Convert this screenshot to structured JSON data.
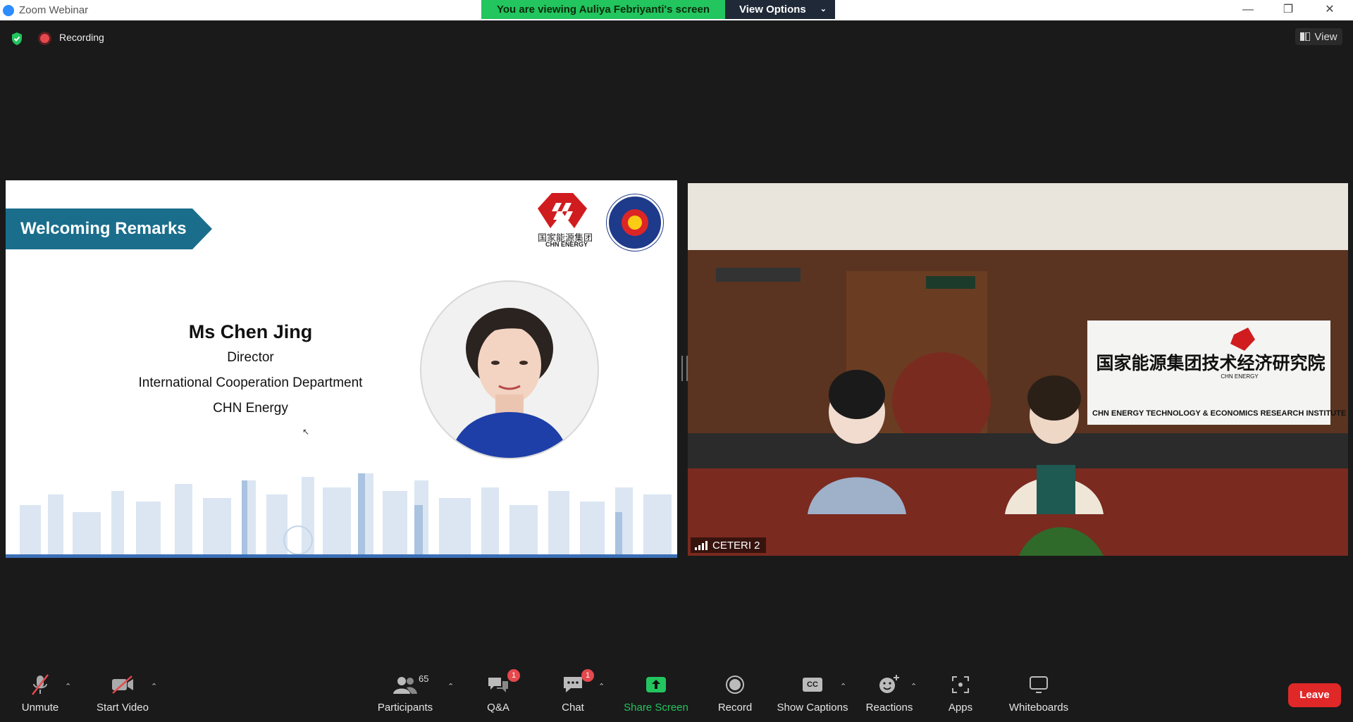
{
  "window": {
    "title": "Zoom Webinar",
    "controls": {
      "minimize": "—",
      "restore": "❐",
      "close": "✕"
    }
  },
  "share_banner": {
    "message": "You are viewing Auliya Febriyanti's screen",
    "options_label": "View Options",
    "color": "#22c55e"
  },
  "status": {
    "recording_label": "Recording",
    "view_label": "View"
  },
  "slide": {
    "heading": "Welcoming Remarks",
    "speaker_name": "Ms Chen Jing",
    "speaker_lines": [
      "Director",
      "International Cooperation Department",
      "CHN Energy"
    ],
    "logo_chn_cn": "国家能源集团",
    "logo_chn_en": "CHN ENERGY"
  },
  "video_tile": {
    "participant": "CETERI 2",
    "banner_cn": "国家能源集团技术经济研究院",
    "banner_en": "CHN ENERGY TECHNOLOGY & ECONOMICS RESEARCH INSTITUTE",
    "banner_logo_sub": "CHN ENERGY"
  },
  "toolbar": {
    "unmute": "Unmute",
    "start_video": "Start Video",
    "participants": "Participants",
    "participants_count": "65",
    "qa": "Q&A",
    "qa_badge": "1",
    "chat": "Chat",
    "chat_badge": "1",
    "share_screen": "Share Screen",
    "record": "Record",
    "show_captions": "Show Captions",
    "captions_icon_text": "CC",
    "reactions": "Reactions",
    "apps": "Apps",
    "whiteboards": "Whiteboards",
    "leave": "Leave"
  },
  "colors": {
    "leave": "#e02828",
    "share_green": "#22c55e",
    "badge": "#e5484d",
    "slide_ribbon": "#1a6e8c"
  }
}
